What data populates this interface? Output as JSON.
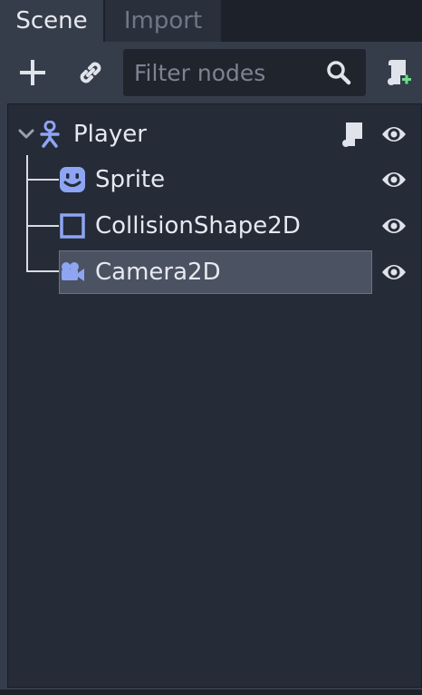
{
  "tabs": [
    {
      "label": "Scene",
      "active": true
    },
    {
      "label": "Import",
      "active": false
    }
  ],
  "toolbar": {
    "add_icon": "plus-icon",
    "link_icon": "link-icon",
    "filter_placeholder": "Filter nodes",
    "search_icon": "search-icon",
    "attach_script_icon": "script-add-icon"
  },
  "tree": {
    "nodes": [
      {
        "label": "Player",
        "icon": "kinematic-body-icon",
        "expanded": true,
        "has_script": true,
        "visible": true
      },
      {
        "label": "Sprite",
        "icon": "sprite-icon",
        "visible": true
      },
      {
        "label": "CollisionShape2D",
        "icon": "collision-shape-icon",
        "visible": true
      },
      {
        "label": "Camera2D",
        "icon": "camera-icon",
        "visible": true,
        "selected": true
      }
    ]
  },
  "colors": {
    "node_icon": "#8da5f3",
    "panel_bg": "#252b37",
    "toolbar_bg": "#363d4a",
    "selected_bg": "#4b5261"
  }
}
